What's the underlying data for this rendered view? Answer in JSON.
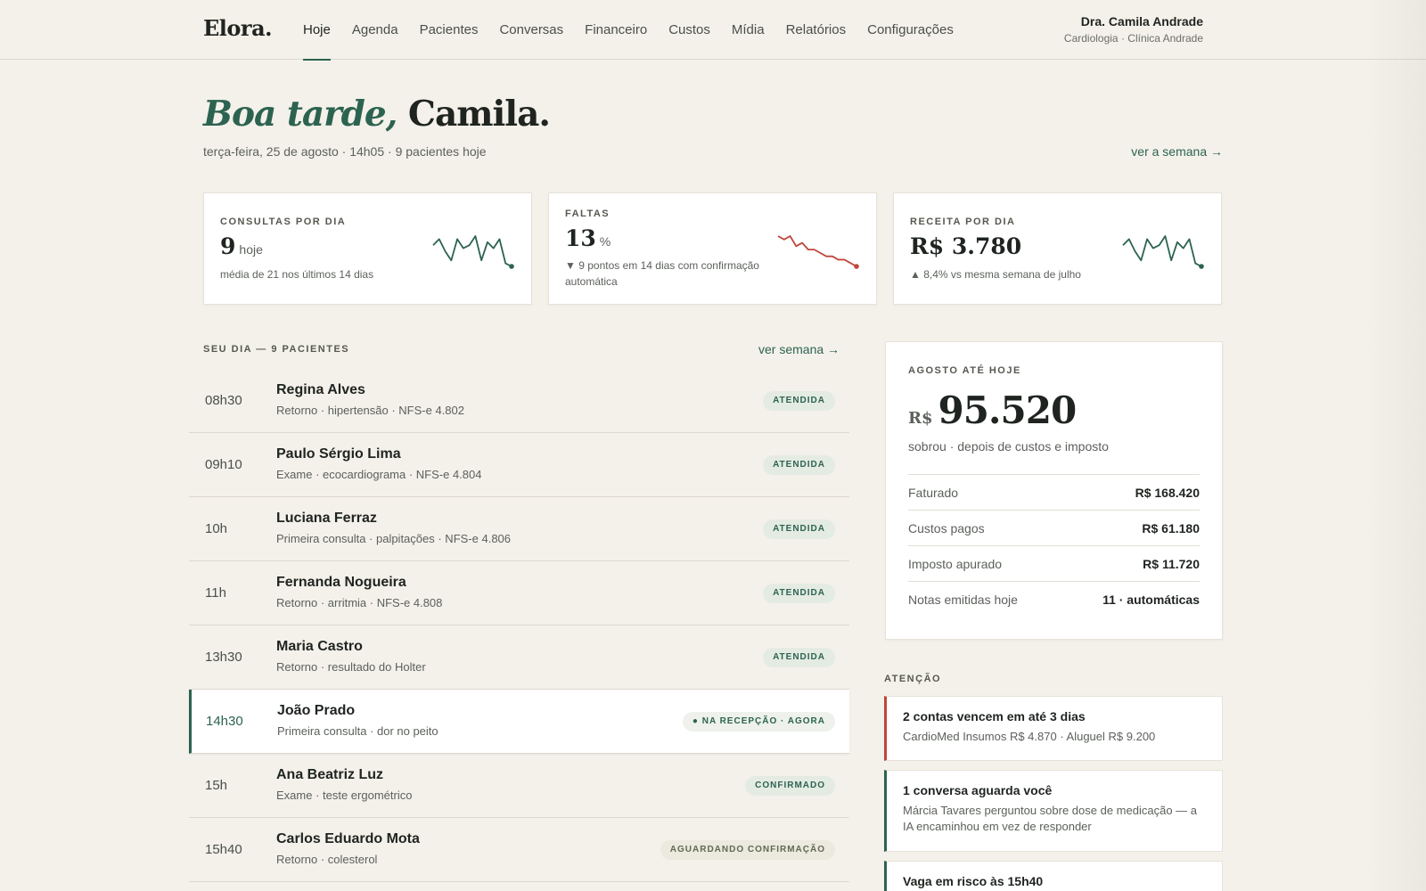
{
  "brand": {
    "logo": "Elora."
  },
  "nav": {
    "items": [
      {
        "label": "Hoje"
      },
      {
        "label": "Agenda"
      },
      {
        "label": "Pacientes"
      },
      {
        "label": "Conversas"
      },
      {
        "label": "Financeiro"
      },
      {
        "label": "Custos"
      },
      {
        "label": "Mídia"
      },
      {
        "label": "Relatórios"
      },
      {
        "label": "Configurações"
      }
    ],
    "active": "Hoje"
  },
  "user": {
    "name": "Dra. Camila Andrade",
    "subtitle": "Cardiologia · Clínica Andrade"
  },
  "greeting": {
    "part1": "Boa tarde,",
    "part2": "Camila.",
    "subline": "terça-feira, 25 de agosto · 14h05 · 9 pacientes hoje",
    "week_link": "ver a semana →"
  },
  "kpis": [
    {
      "label": "CONSULTAS POR DIA",
      "value": "9",
      "unit": "hoje",
      "note": "média de 21 nos últimos 14 dias",
      "spark_color": "#2c6350",
      "spark": [
        11,
        13,
        9,
        6,
        13,
        10,
        11,
        14,
        6,
        12,
        10,
        13,
        5,
        4
      ]
    },
    {
      "label": "FALTAS",
      "value": "13",
      "unit": "%",
      "note": "▼ 9 pontos em 14 dias com confirmação automática",
      "spark_color": "#c0463a",
      "spark": [
        22,
        21,
        22,
        19,
        20,
        18,
        18,
        17,
        16,
        16,
        15,
        15,
        14,
        13
      ]
    },
    {
      "label": "RECEITA POR DIA",
      "value": "R$ 3.780",
      "unit": "",
      "note": "▲ 8,4% vs mesma semana de julho",
      "spark_color": "#2c6350",
      "spark": [
        11,
        13,
        9,
        6,
        13,
        10,
        11,
        14,
        6,
        12,
        10,
        13,
        5,
        4
      ]
    }
  ],
  "day": {
    "heading": "SEU DIA — 9 PACIENTES",
    "link": "ver semana →",
    "appointments": [
      {
        "time": "08h30",
        "name": "Regina Alves",
        "desc": "Retorno · hipertensão · NFS-e 4.802",
        "status": "ATENDIDA",
        "kind": "done"
      },
      {
        "time": "09h10",
        "name": "Paulo Sérgio Lima",
        "desc": "Exame · ecocardiograma · NFS-e 4.804",
        "status": "ATENDIDA",
        "kind": "done"
      },
      {
        "time": "10h",
        "name": "Luciana Ferraz",
        "desc": "Primeira consulta · palpitações · NFS-e 4.806",
        "status": "ATENDIDA",
        "kind": "done"
      },
      {
        "time": "11h",
        "name": "Fernanda Nogueira",
        "desc": "Retorno · arritmia · NFS-e 4.808",
        "status": "ATENDIDA",
        "kind": "done"
      },
      {
        "time": "13h30",
        "name": "Maria Castro",
        "desc": "Retorno · resultado do Holter",
        "status": "ATENDIDA",
        "kind": "done"
      },
      {
        "time": "14h30",
        "name": "João Prado",
        "desc": "Primeira consulta · dor no peito",
        "status": "● NA RECEPÇÃO · AGORA",
        "kind": "now"
      },
      {
        "time": "15h",
        "name": "Ana Beatriz Luz",
        "desc": "Exame · teste ergométrico",
        "status": "CONFIRMADO",
        "kind": "conf"
      },
      {
        "time": "15h40",
        "name": "Carlos Eduardo Mota",
        "desc": "Retorno · colesterol",
        "status": "AGUARDANDO CONFIRMAÇÃO",
        "kind": "wait"
      }
    ]
  },
  "summary": {
    "label": "AGOSTO ATÉ HOJE",
    "currency": "R$",
    "amount": "95.520",
    "subtitle": "sobrou · depois de custos e imposto",
    "rows": [
      {
        "k": "Faturado",
        "v": "R$ 168.420"
      },
      {
        "k": "Custos pagos",
        "v": "R$ 61.180"
      },
      {
        "k": "Imposto apurado",
        "v": "R$ 11.720"
      },
      {
        "k": "Notas emitidas hoje",
        "v": "11 · automáticas"
      }
    ]
  },
  "attention": {
    "heading": "ATENÇÃO",
    "alerts": [
      {
        "title": "2 contas vencem em até 3 dias",
        "text": "CardioMed Insumos R$ 4.870 · Aluguel R$ 9.200",
        "color": "red"
      },
      {
        "title": "1 conversa aguarda você",
        "text": "Márcia Tavares perguntou sobre dose de medicação — a IA encaminhou em vez de responder",
        "color": "green"
      },
      {
        "title": "Vaga em risco às 15h40",
        "text": "",
        "color": "green"
      }
    ]
  }
}
